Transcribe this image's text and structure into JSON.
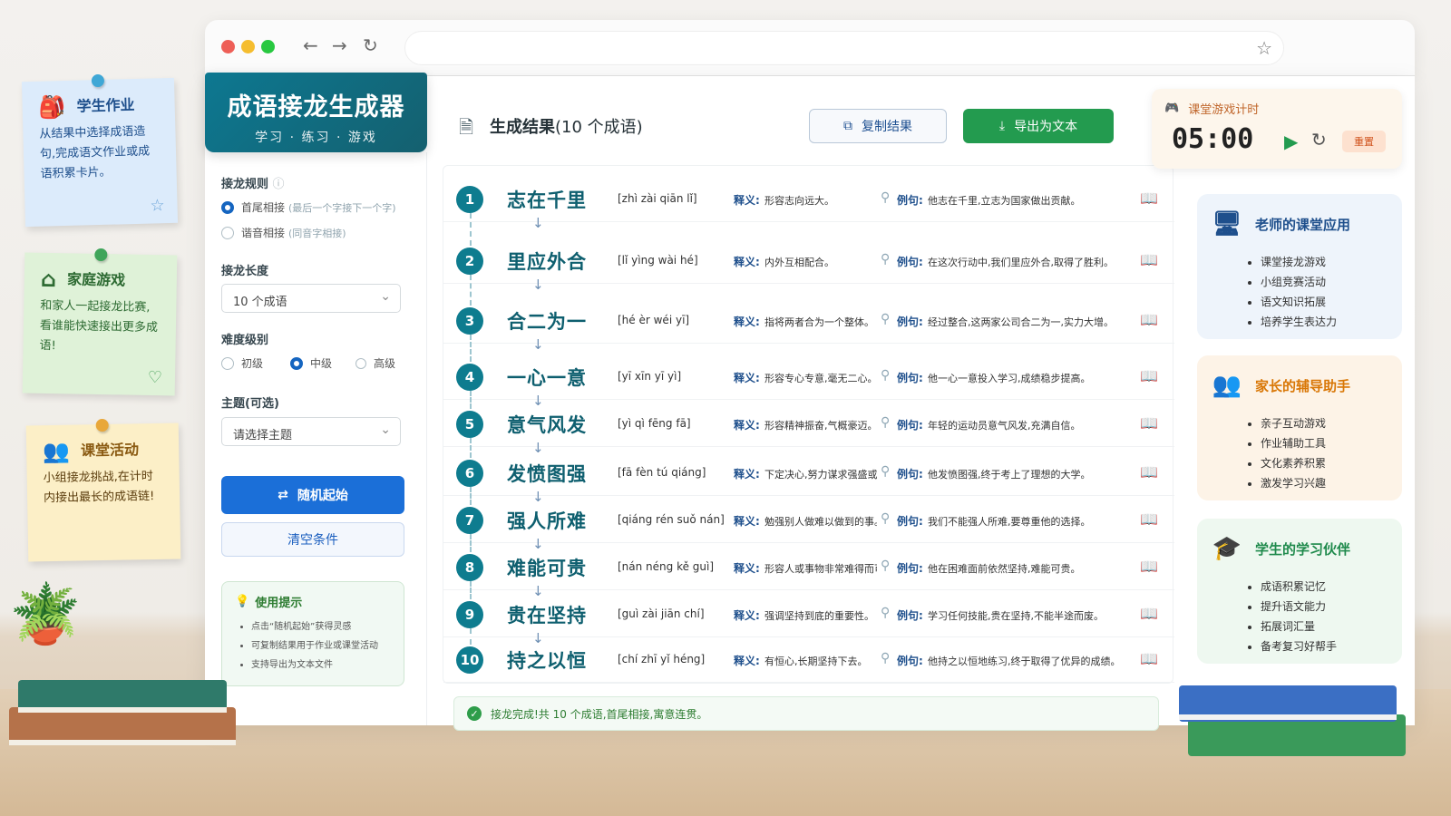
{
  "brand": {
    "title": "成语接龙生成器",
    "subtitle": "学习 · 练习 · 游戏"
  },
  "browser": {
    "back_icon": "←",
    "forward_icon": "→",
    "reload_icon": "↻",
    "star_icon": "☆"
  },
  "settings": {
    "rule_label": "接龙规则",
    "rule_info": "ⓘ",
    "rules": [
      {
        "label": "首尾相接",
        "hint": "(最后一个字接下一个字)",
        "selected": true
      },
      {
        "label": "谐音相接",
        "hint": "(同音字相接)",
        "selected": false
      }
    ],
    "length_label": "接龙长度",
    "length_value": "10 个成语",
    "difficulty_label": "难度级别",
    "difficulties": [
      {
        "label": "初级",
        "selected": false
      },
      {
        "label": "中级",
        "selected": true
      },
      {
        "label": "高级",
        "selected": false
      }
    ],
    "theme_label": "主题(可选)",
    "theme_placeholder": "请选择主题",
    "random_button": "随机起始",
    "clear_button": "清空条件",
    "tips_title": "使用提示",
    "tips": [
      "点击“随机起始”获得灵感",
      "可复制结果用于作业或课堂活动",
      "支持导出为文本文件"
    ]
  },
  "results": {
    "title": "生成结果",
    "count_note": "(10 个成语)",
    "copy_button": "复制结果",
    "export_button": "导出为文本",
    "meaning_label": "释义:",
    "example_label": "例句:",
    "items": [
      {
        "n": "1",
        "idiom": "志在千里",
        "pinyin": "[zhì zài qiān lǐ]",
        "meaning": "形容志向远大。",
        "example": "他志在千里,立志为国家做出贡献。"
      },
      {
        "n": "2",
        "idiom": "里应外合",
        "pinyin": "[lǐ yìng wài hé]",
        "meaning": "内外互相配合。",
        "example": "在这次行动中,我们里应外合,取得了胜利。"
      },
      {
        "n": "3",
        "idiom": "合二为一",
        "pinyin": "[hé èr wéi yī]",
        "meaning": "指将两者合为一个整体。",
        "example": "经过整合,这两家公司合二为一,实力大增。"
      },
      {
        "n": "4",
        "idiom": "一心一意",
        "pinyin": "[yī xīn yī yì]",
        "meaning": "形容专心专意,毫无二心。",
        "example": "他一心一意投入学习,成绩稳步提高。"
      },
      {
        "n": "5",
        "idiom": "意气风发",
        "pinyin": "[yì qì fēng fā]",
        "meaning": "形容精神振奋,气概豪迈。",
        "example": "年轻的运动员意气风发,充满自信。"
      },
      {
        "n": "6",
        "idiom": "发愤图强",
        "pinyin": "[fā fèn tú qiáng]",
        "meaning": "下定决心,努力谋求强盛或进步。",
        "example": "他发愤图强,终于考上了理想的大学。"
      },
      {
        "n": "7",
        "idiom": "强人所难",
        "pinyin": "[qiáng rén suǒ nán]",
        "meaning": "勉强别人做难以做到的事。",
        "example": "我们不能强人所难,要尊重他的选择。"
      },
      {
        "n": "8",
        "idiom": "难能可贵",
        "pinyin": "[nán néng kě guì]",
        "meaning": "形容人或事物非常难得而可贵。",
        "example": "他在困难面前依然坚持,难能可贵。"
      },
      {
        "n": "9",
        "idiom": "贵在坚持",
        "pinyin": "[guì zài jiān chí]",
        "meaning": "强调坚持到底的重要性。",
        "example": "学习任何技能,贵在坚持,不能半途而废。"
      },
      {
        "n": "10",
        "idiom": "持之以恒",
        "pinyin": "[chí zhī yǐ héng]",
        "meaning": "有恒心,长期坚持下去。",
        "example": "他持之以恒地练习,终于取得了优异的成绩。"
      }
    ],
    "done_text": "接龙完成!共 10 个成语,首尾相接,寓意连贯。"
  },
  "timer": {
    "title": "课堂游戏计时",
    "time": "05:00",
    "reset": "重置"
  },
  "cards": [
    {
      "title": "老师的课堂应用",
      "icon": "teacher-board-icon",
      "color": "#1e4f8c",
      "bg": "#eef4fb",
      "items": [
        "课堂接龙游戏",
        "小组竞赛活动",
        "语文知识拓展",
        "培养学生表达力"
      ]
    },
    {
      "title": "家长的辅导助手",
      "icon": "parents-icon",
      "color": "#d97706",
      "bg": "#fdf3e7",
      "items": [
        "亲子互动游戏",
        "作业辅助工具",
        "文化素养积累",
        "激发学习兴趣"
      ]
    },
    {
      "title": "学生的学习伙伴",
      "icon": "graduation-cap-icon",
      "color": "#1f8a4c",
      "bg": "#eef8f0",
      "items": [
        "成语积累记忆",
        "提升语文能力",
        "拓展词汇量",
        "备考复习好帮手"
      ]
    }
  ],
  "notes": [
    {
      "title": "学生作业",
      "text": "从结果中选择成语造句,完成语文作业或成语积累卡片。",
      "bg": "#dcebfb",
      "pin": "#3fa7d6"
    },
    {
      "title": "家庭游戏",
      "text": "和家人一起接龙比赛,看谁能快速接出更多成语!",
      "bg": "#dff2d8",
      "pin": "#3fa55a"
    },
    {
      "title": "课堂活动",
      "text": "小组接龙挑战,在计时内接出最长的成语链!",
      "bg": "#fcefc7",
      "pin": "#e8a73a"
    }
  ]
}
